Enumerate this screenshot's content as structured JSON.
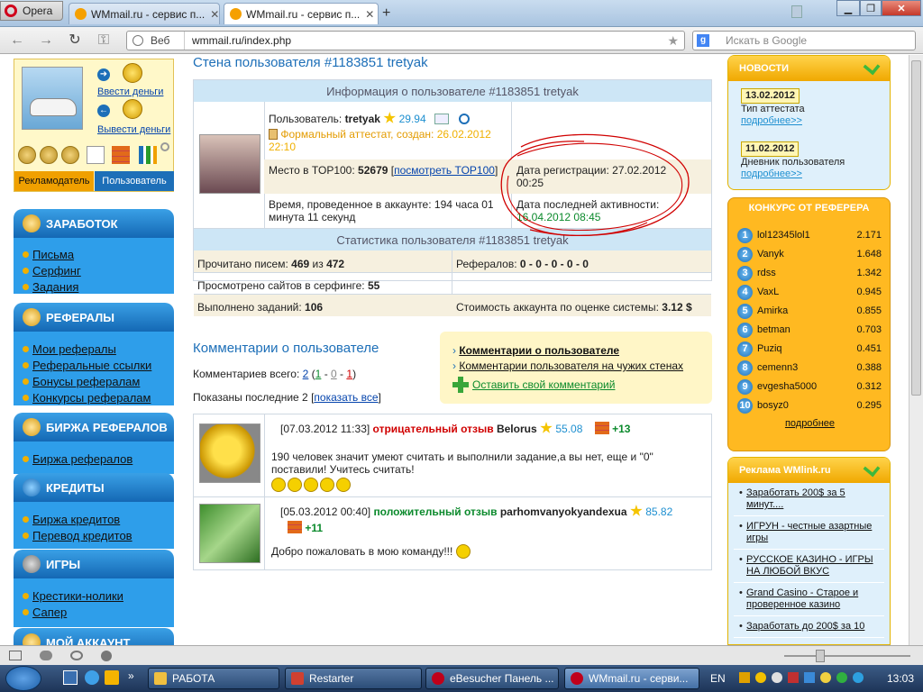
{
  "browser": {
    "opera_button": "Opera",
    "tabs": [
      {
        "title": "WMmail.ru - сервис п...",
        "active": false
      },
      {
        "title": "WMmail.ru - сервис п...",
        "active": true
      }
    ],
    "new_tab": "+",
    "nav": {
      "back": "←",
      "forward": "→",
      "reload": "↻",
      "key": "⚿"
    },
    "address": {
      "scheme_label": "Веб",
      "url": "wmmail.ru/index.php"
    },
    "search": {
      "placeholder": "Искать в Google"
    }
  },
  "left": {
    "deposit": "Ввести деньги",
    "withdraw": "Вывести деньги",
    "roles": {
      "advertiser": "Рекламодатель",
      "user": "Пользователь"
    },
    "sections": [
      {
        "title": "ЗАРАБОТОК",
        "items": [
          "Письма",
          "Серфинг",
          "Задания"
        ]
      },
      {
        "title": "РЕФЕРАЛЫ",
        "items": [
          "Мои рефералы",
          "Реферальные ссылки",
          "Бонусы рефералам",
          "Конкурсы рефералам"
        ]
      },
      {
        "title": "БИРЖА РЕФЕРАЛОВ",
        "items": [
          "Биржа рефералов"
        ]
      },
      {
        "title": "КРЕДИТЫ",
        "items": [
          "Биржа кредитов",
          "Перевод кредитов"
        ]
      },
      {
        "title": "ИГРЫ",
        "items": [
          "Крестики-нолики",
          "Сапер"
        ]
      },
      {
        "title": "МОЙ АККАУНТ",
        "items": []
      }
    ]
  },
  "main": {
    "title": "Стена пользователя #1183851 tretyak",
    "info_header": "Информация о пользователе #1183851 tretyak",
    "user_label": "Пользователь:",
    "username": "tretyak",
    "rating": "29.94",
    "attestat": "Формальный аттестат, создан:",
    "attestat_date": "26.02.2012 22:10",
    "top100_label": "Место в TOP100:",
    "top100_value": "52679",
    "top100_link": "посмотреть TOP100",
    "reg_label": "Дата регистрации:",
    "reg_value": "27.02.2012 00:25",
    "time_label": "Время, проведенное в аккаунте:",
    "time_value": "194 часа 01 минута 11 секунд",
    "last_label": "Дата последней активности:",
    "last_value": "16.04.2012 08:45",
    "stats_header": "Статистика пользователя #1183851 tretyak",
    "stats": {
      "read_label": "Прочитано писем:",
      "read_value": "469",
      "read_of": "из",
      "read_total": "472",
      "refs_label": "Рефералов:",
      "refs_value": "0 - 0 - 0 - 0 - 0",
      "surf_label": "Просмотрено сайтов в серфинге:",
      "surf_value": "55",
      "tasks_label": "Выполнено заданий:",
      "tasks_value": "106",
      "cost_label": "Стоимость аккаунта по оценке системы:",
      "cost_value": "3.12 $"
    },
    "comments_title": "Комментарии о пользователе",
    "comments_total_label": "Комментариев всего:",
    "comments_total": "2",
    "comments_pos": "1",
    "comments_neu": "0",
    "comments_neg": "1",
    "shown_label": "Показаны последние",
    "shown_count": "2",
    "show_all": "показать все",
    "box_links": [
      "Комментарии о пользователе",
      "Комментарии пользователя на чужих стенах"
    ],
    "leave_comment": "Оставить свой комментарий",
    "comments": [
      {
        "date": "[07.03.2012 11:33]",
        "type": "отрицательный отзыв",
        "author": "Belorus",
        "author_rating": "55.08",
        "score": "+13",
        "text": "190 человек значит умеют считать и выполнили задание,а вы нет, еще и \"0\" поставили! Учитесь считать!"
      },
      {
        "date": "[05.03.2012 00:40]",
        "type": "положительный отзыв",
        "author": "parhomvanyokyandexua",
        "author_rating": "85.82",
        "score": "+11",
        "text": "Добро пожаловать в мою команду!!!"
      }
    ]
  },
  "right": {
    "news_title": "НОВОСТИ",
    "news": [
      {
        "date": "13.02.2012",
        "title": "Тип аттестата",
        "more": "подробнее>>"
      },
      {
        "date": "11.02.2012",
        "title": "Дневник пользователя",
        "more": "подробнее>>"
      }
    ],
    "contest_title": "КОНКУРС ОТ РЕФЕРЕРА",
    "contest": [
      {
        "n": "1",
        "name": "lol12345lol1",
        "value": "2.171"
      },
      {
        "n": "2",
        "name": "Vanyk",
        "value": "1.648"
      },
      {
        "n": "3",
        "name": "rdss",
        "value": "1.342"
      },
      {
        "n": "4",
        "name": "VaxL",
        "value": "0.945"
      },
      {
        "n": "5",
        "name": "Amirka",
        "value": "0.855"
      },
      {
        "n": "6",
        "name": "betman",
        "value": "0.703"
      },
      {
        "n": "7",
        "name": "Puziq",
        "value": "0.451"
      },
      {
        "n": "8",
        "name": "cemenn3",
        "value": "0.388"
      },
      {
        "n": "9",
        "name": "evgesha5000",
        "value": "0.312"
      },
      {
        "n": "10",
        "name": "bosyz0",
        "value": "0.295"
      }
    ],
    "contest_more": "подробнее",
    "ads_title": "Реклама WMlink.ru",
    "ads": [
      "Заработать 200$ за 5 минут....",
      "ИГРУН - честные азартные игры",
      "РУССКОЕ КАЗИНО - ИГРЫ НА ЛЮБОЙ ВКУС",
      "Grand Casino - Старое и проверенное казино",
      "Заработать до 200$ за 10"
    ]
  },
  "taskbar": {
    "tasks": [
      "РАБОТА",
      "Restarter",
      "eBesucher Панель ...",
      "WMmail.ru - серви..."
    ],
    "lang": "EN",
    "clock": "13:03"
  },
  "colors": {
    "accent_blue": "#1d6fb8",
    "nav_blue": "#2e9eea",
    "contest_orange": "#ffb921",
    "red": "#d00000",
    "green": "#0b8a2c"
  }
}
